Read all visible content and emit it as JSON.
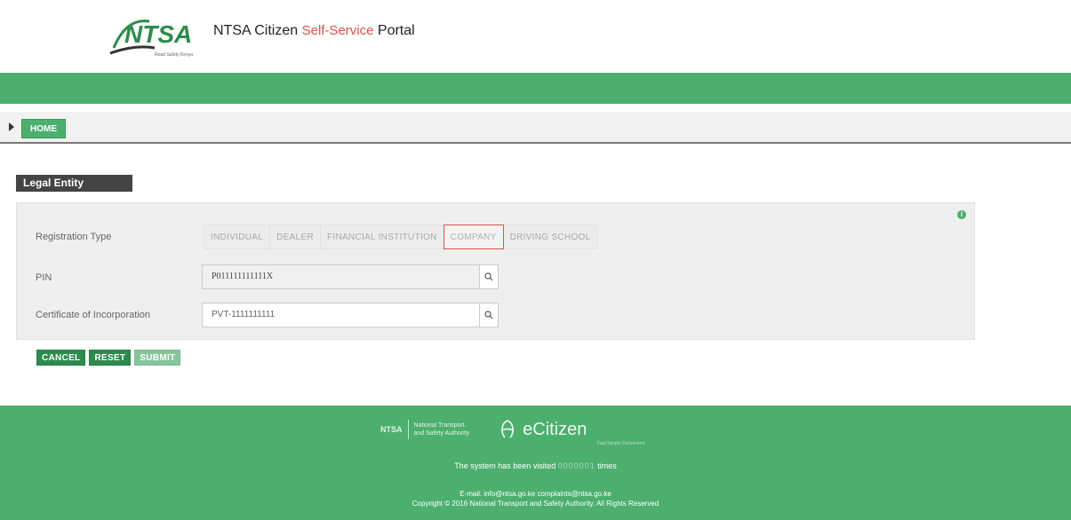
{
  "header": {
    "logo_text": "NTSA",
    "logo_tagline": "Road Safety Kenya",
    "title_prefix": "NTSA Citizen ",
    "title_accent": "Self-Service",
    "title_suffix": " Portal"
  },
  "breadcrumb": {
    "home_label": "HOME"
  },
  "section": {
    "title": "Legal Entity"
  },
  "form": {
    "registration_type": {
      "label": "Registration Type",
      "options": [
        "INDIVIDUAL",
        "DEALER",
        "FINANCIAL INSTITUTION",
        "COMPANY",
        "DRIVING SCHOOL"
      ],
      "selected": "COMPANY"
    },
    "pin": {
      "label": "PIN",
      "value": "P011111111111X"
    },
    "certificate": {
      "label": "Certificate of Incorporation",
      "value": "PVT-1111111111"
    }
  },
  "actions": {
    "cancel": "CANCEL",
    "reset": "RESET",
    "submit": "SUBMIT"
  },
  "footer": {
    "ntsa_mark": "NTSA",
    "ntsa_name_line1": "National Transport",
    "ntsa_name_line2": "and Safety Authority",
    "ecitizen": "eCitizen",
    "ecitizen_tag": "Fast Simple Convenient",
    "visits_prefix": "The system has been visited ",
    "visits_count": "0000001",
    "visits_suffix": " times",
    "email_line": "E-mail: info@ntsa.go.ke    complaints@ntsa.go.ke",
    "copyright": "Copyright © 2016 National Transport and Safety Authority. All Rights Reserved"
  },
  "colors": {
    "brand_green": "#4caf6e",
    "button_green": "#2e8b4e",
    "selected_border": "#d9534f"
  }
}
